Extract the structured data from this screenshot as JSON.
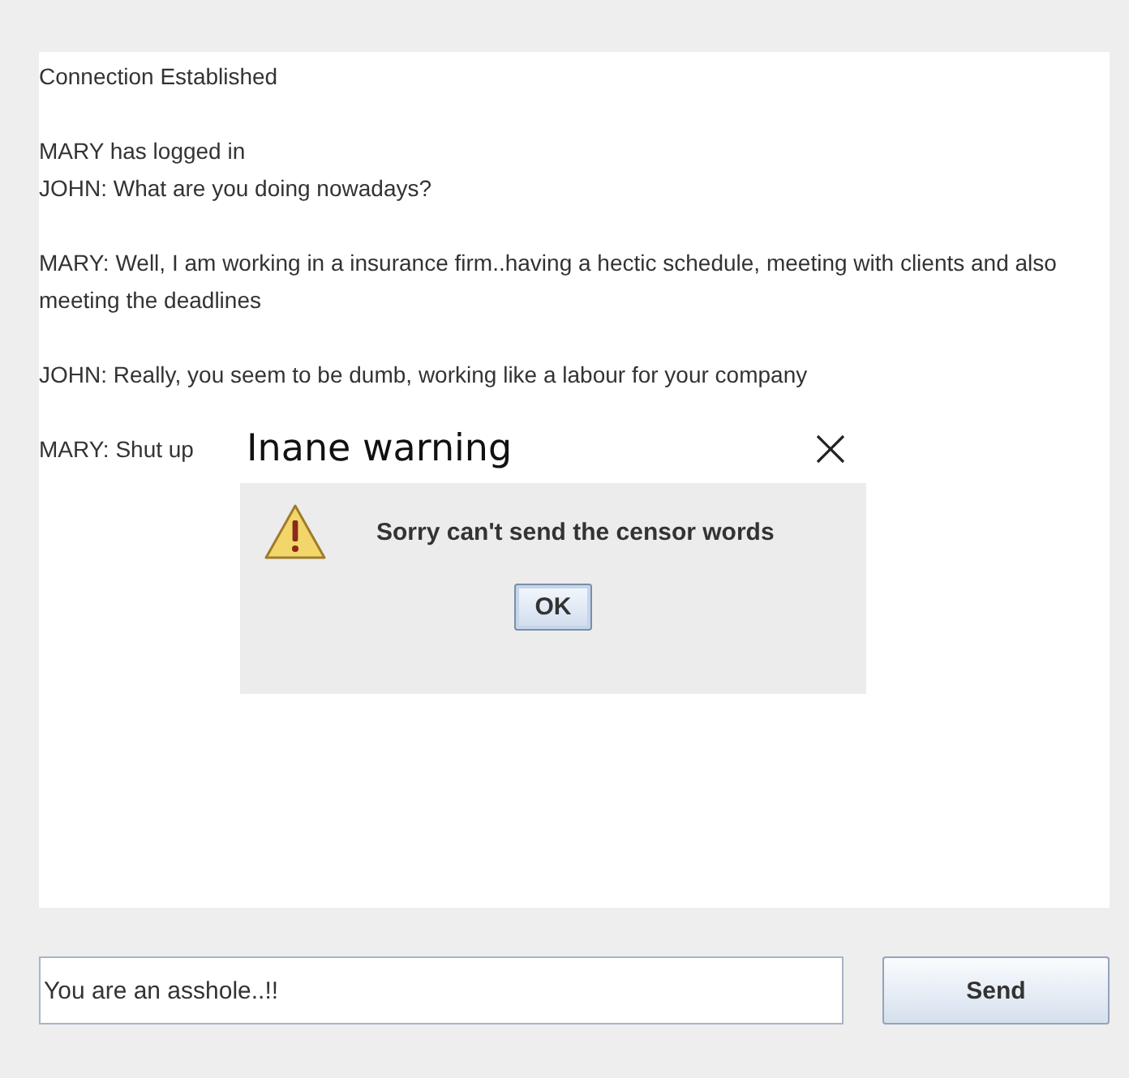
{
  "chat": {
    "paragraphs": [
      {
        "lines": [
          "Connection Established"
        ]
      },
      {
        "lines": [
          "MARY has logged in",
          "JOHN: What are you doing nowadays?"
        ]
      },
      {
        "lines": [
          "MARY: Well, I am working in a insurance firm..having a hectic schedule, meeting with clients and also meeting the deadlines"
        ]
      },
      {
        "lines": [
          "JOHN: Really, you seem to be dumb, working like a labour for your company"
        ]
      },
      {
        "lines": [
          "MARY: Shut up"
        ]
      }
    ]
  },
  "dialog": {
    "title": "Inane warning",
    "message": "Sorry can't send the censor words",
    "button": "OK"
  },
  "input": {
    "value": "You are an asshole..!!"
  },
  "send_button": "Send"
}
